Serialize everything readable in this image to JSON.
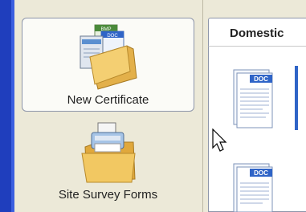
{
  "sidebar": {
    "items": [
      {
        "label": "New Certificate",
        "icon": "certificate-folder-icon",
        "selected": true
      },
      {
        "label": "Site Survey Forms",
        "icon": "survey-printer-folder-icon",
        "selected": false
      }
    ],
    "folder_badges": {
      "bmp": "BMP",
      "doc": "DOC"
    }
  },
  "content": {
    "tab_label": "Domestic",
    "docs": [
      {
        "badge": "DOC",
        "icon": "doc-file-icon"
      },
      {
        "badge": "DOC",
        "icon": "doc-file-icon"
      }
    ]
  },
  "colors": {
    "accent_bar": "#1f3ebd",
    "panel_bg": "#ece9d8",
    "doc_badge": "#2f64c7"
  }
}
